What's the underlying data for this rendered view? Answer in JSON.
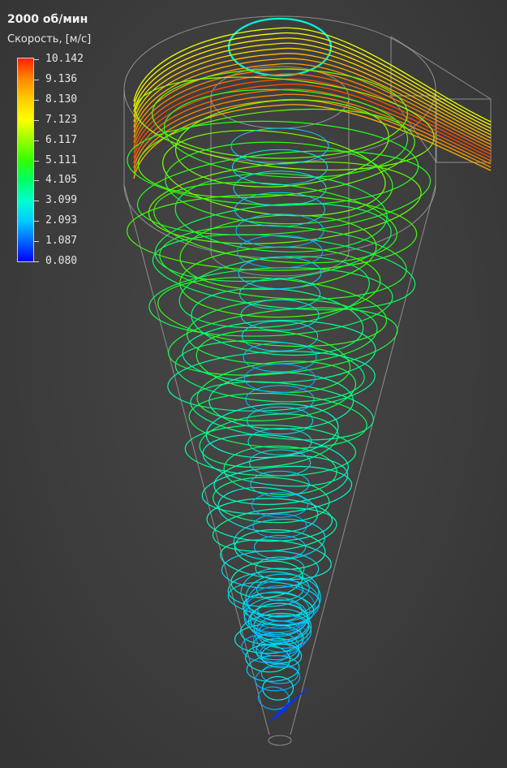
{
  "title": "2000 об/мин",
  "quantity_label": "Скорость, [м/с]",
  "colorbar": {
    "min": 0.08,
    "max": 10.142,
    "ticks": [
      "10.142",
      "9.136",
      "8.130",
      "7.123",
      "6.117",
      "5.111",
      "4.105",
      "3.099",
      "2.093",
      "1.087",
      "0.080"
    ],
    "colors": [
      "#0000ff",
      "#0066ff",
      "#00ccff",
      "#00ffcc",
      "#00ff66",
      "#33ff00",
      "#99ff00",
      "#ffff00",
      "#ffcc00",
      "#ff8800",
      "#ff2200"
    ]
  }
}
